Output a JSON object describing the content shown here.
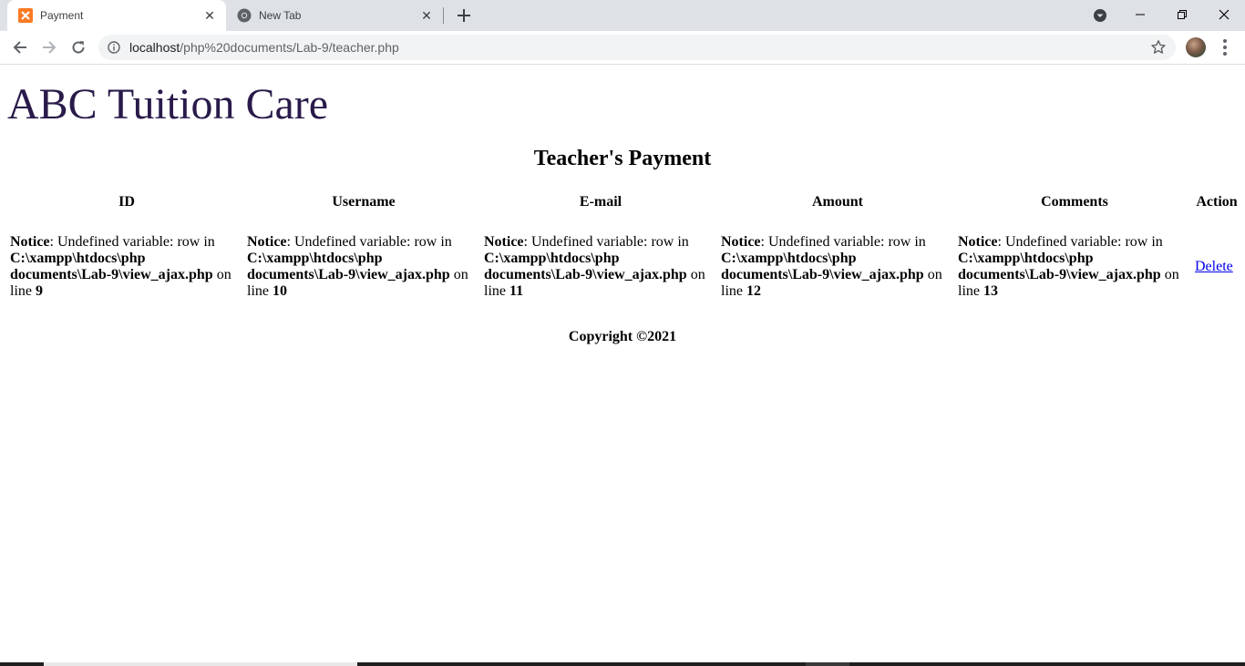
{
  "browser": {
    "tabs": [
      {
        "label": "Payment",
        "icon": "xampp-icon",
        "active": true
      },
      {
        "label": "New Tab",
        "icon": "chrome-icon",
        "active": false
      }
    ],
    "url_host": "localhost",
    "url_path": "/php%20documents/Lab-9/teacher.php"
  },
  "page": {
    "site_title": "ABC Tuition Care",
    "section_title": "Teacher's Payment",
    "columns": [
      "ID",
      "Username",
      "E-mail",
      "Amount",
      "Comments",
      "Action"
    ],
    "notice_label": "Notice",
    "notice_message": ": Undefined variable: row in",
    "notice_path_1": "C:\\xampp\\htdocs\\php",
    "notice_path_2": "documents\\Lab-9\\view_ajax.php",
    "notice_on": " on",
    "notice_line_word": "line ",
    "cells": [
      {
        "line": "9"
      },
      {
        "line": "10"
      },
      {
        "line": "11"
      },
      {
        "line": "12"
      },
      {
        "line": "13"
      }
    ],
    "action_link": "Delete",
    "footer": "Copyright ©2021"
  },
  "colors": {
    "title": "#2a1a4a",
    "link": "#0000ee",
    "tabstrip": "#dee1e6",
    "xampp_orange": "#fb7a24"
  }
}
